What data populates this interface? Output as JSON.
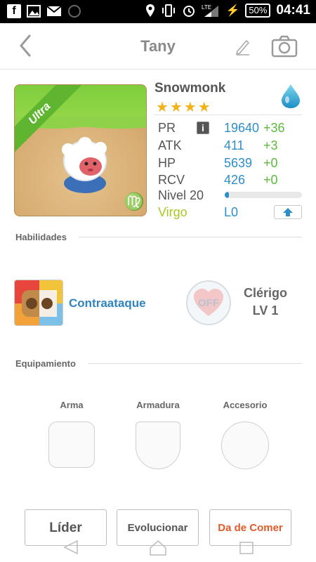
{
  "status_bar": {
    "time": "04:41",
    "battery": "50%",
    "network": "LTE"
  },
  "header": {
    "title": "Tany",
    "back_icon": "chevron-left-icon",
    "edit_icon": "pencil-icon",
    "camera_icon": "camera-icon"
  },
  "monster": {
    "name": "Snowmonk",
    "rarity": "Ultra",
    "stars": "★★★★",
    "star_count": 4,
    "element_icon": "water-drop-icon",
    "zodiac_symbol": "♍",
    "stats": [
      {
        "label": "PR",
        "value": "19640",
        "bonus": "+36"
      },
      {
        "label": "ATK",
        "value": "411",
        "bonus": "+3"
      },
      {
        "label": "HP",
        "value": "5639",
        "bonus": "+0"
      },
      {
        "label": "RCV",
        "value": "426",
        "bonus": "+0"
      }
    ],
    "level_label": "Nivel 20",
    "level_progress": 0.05,
    "sign_label": "Virgo",
    "limit_label": "L0"
  },
  "skills": {
    "section_label": "Habilidades",
    "active_skill": "Contraataque",
    "leader_badge": "OFF",
    "leader_skill": "Clérigo",
    "leader_level": "LV 1"
  },
  "equipment": {
    "section_label": "Equipamiento",
    "weapon": "Arma",
    "armor": "Armadura",
    "accessory": "Accesorio"
  },
  "actions": {
    "leader": "Líder",
    "evolve": "Evolucionar",
    "feed": "Da de Comer"
  },
  "colors": {
    "accent_blue": "#2e8ec9",
    "bonus_green": "#5cbb3a",
    "ultra_green": "#5fb52f",
    "feed_orange": "#e05a2a",
    "star_gold": "#f3b21a"
  }
}
